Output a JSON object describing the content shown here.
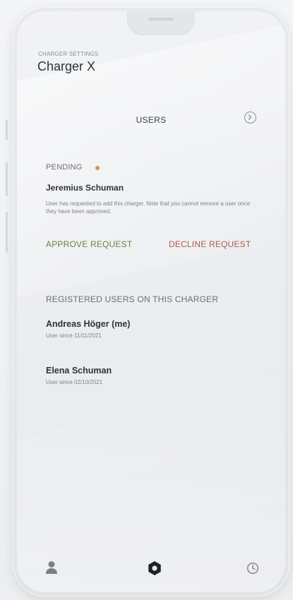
{
  "header": {
    "eyebrow": "CHARGER SETTINGS",
    "title": "Charger X"
  },
  "section": {
    "title": "USERS",
    "info_icon": "chevron-circle-icon"
  },
  "pending_request": {
    "status_label": "PENDING",
    "status_color": "#c99a49",
    "name": "Jeremius Schuman",
    "note": "User has requested to add this charger. Note that you cannot remove a user once they have been approved.",
    "approve_label": "APPROVE REQUEST",
    "approve_color": "#6e7f3a",
    "decline_label": "DECLINE REQUEST",
    "decline_color": "#b35a4d"
  },
  "registered": {
    "title": "REGISTERED USERS ON THIS CHARGER",
    "users": [
      {
        "name": "Andreas Höger (me)",
        "since": "User since 11/11/2021"
      },
      {
        "name": "Elena Schuman",
        "since": "User since 02/10/2021"
      }
    ]
  },
  "bottom_nav": {
    "items": [
      {
        "icon": "user-icon"
      },
      {
        "icon": "hexagon-charger-icon",
        "active": true
      },
      {
        "icon": "clock-icon"
      }
    ]
  }
}
